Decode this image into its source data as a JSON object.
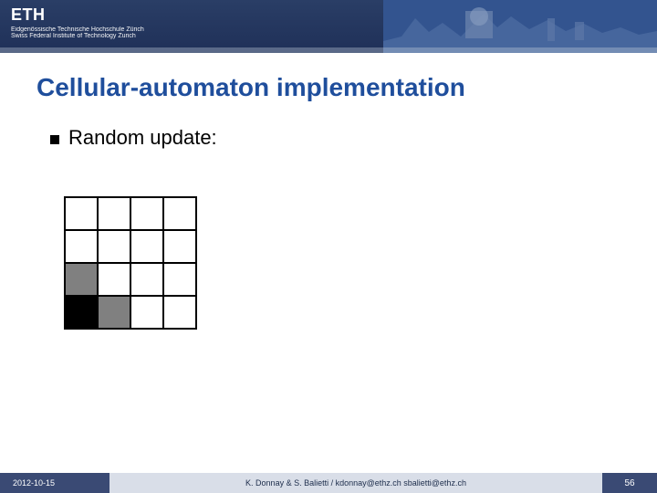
{
  "banner": {
    "logo": "ETH",
    "subline1": "Eidgenössische Technische Hochschule Zürich",
    "subline2": "Swiss Federal Institute of Technology Zurich"
  },
  "title": "Cellular-automaton implementation",
  "bullet": {
    "text": "Random update:"
  },
  "grid": {
    "rows": 4,
    "cols": 4,
    "cells": [
      [
        "white",
        "white",
        "white",
        "white"
      ],
      [
        "white",
        "white",
        "white",
        "white"
      ],
      [
        "gray",
        "white",
        "white",
        "white"
      ],
      [
        "black",
        "gray",
        "white",
        "white"
      ]
    ]
  },
  "footer": {
    "date": "2012-10-15",
    "credits": "K. Donnay & S. Balietti / kdonnay@ethz.ch  sbalietti@ethz.ch",
    "page": "56"
  }
}
